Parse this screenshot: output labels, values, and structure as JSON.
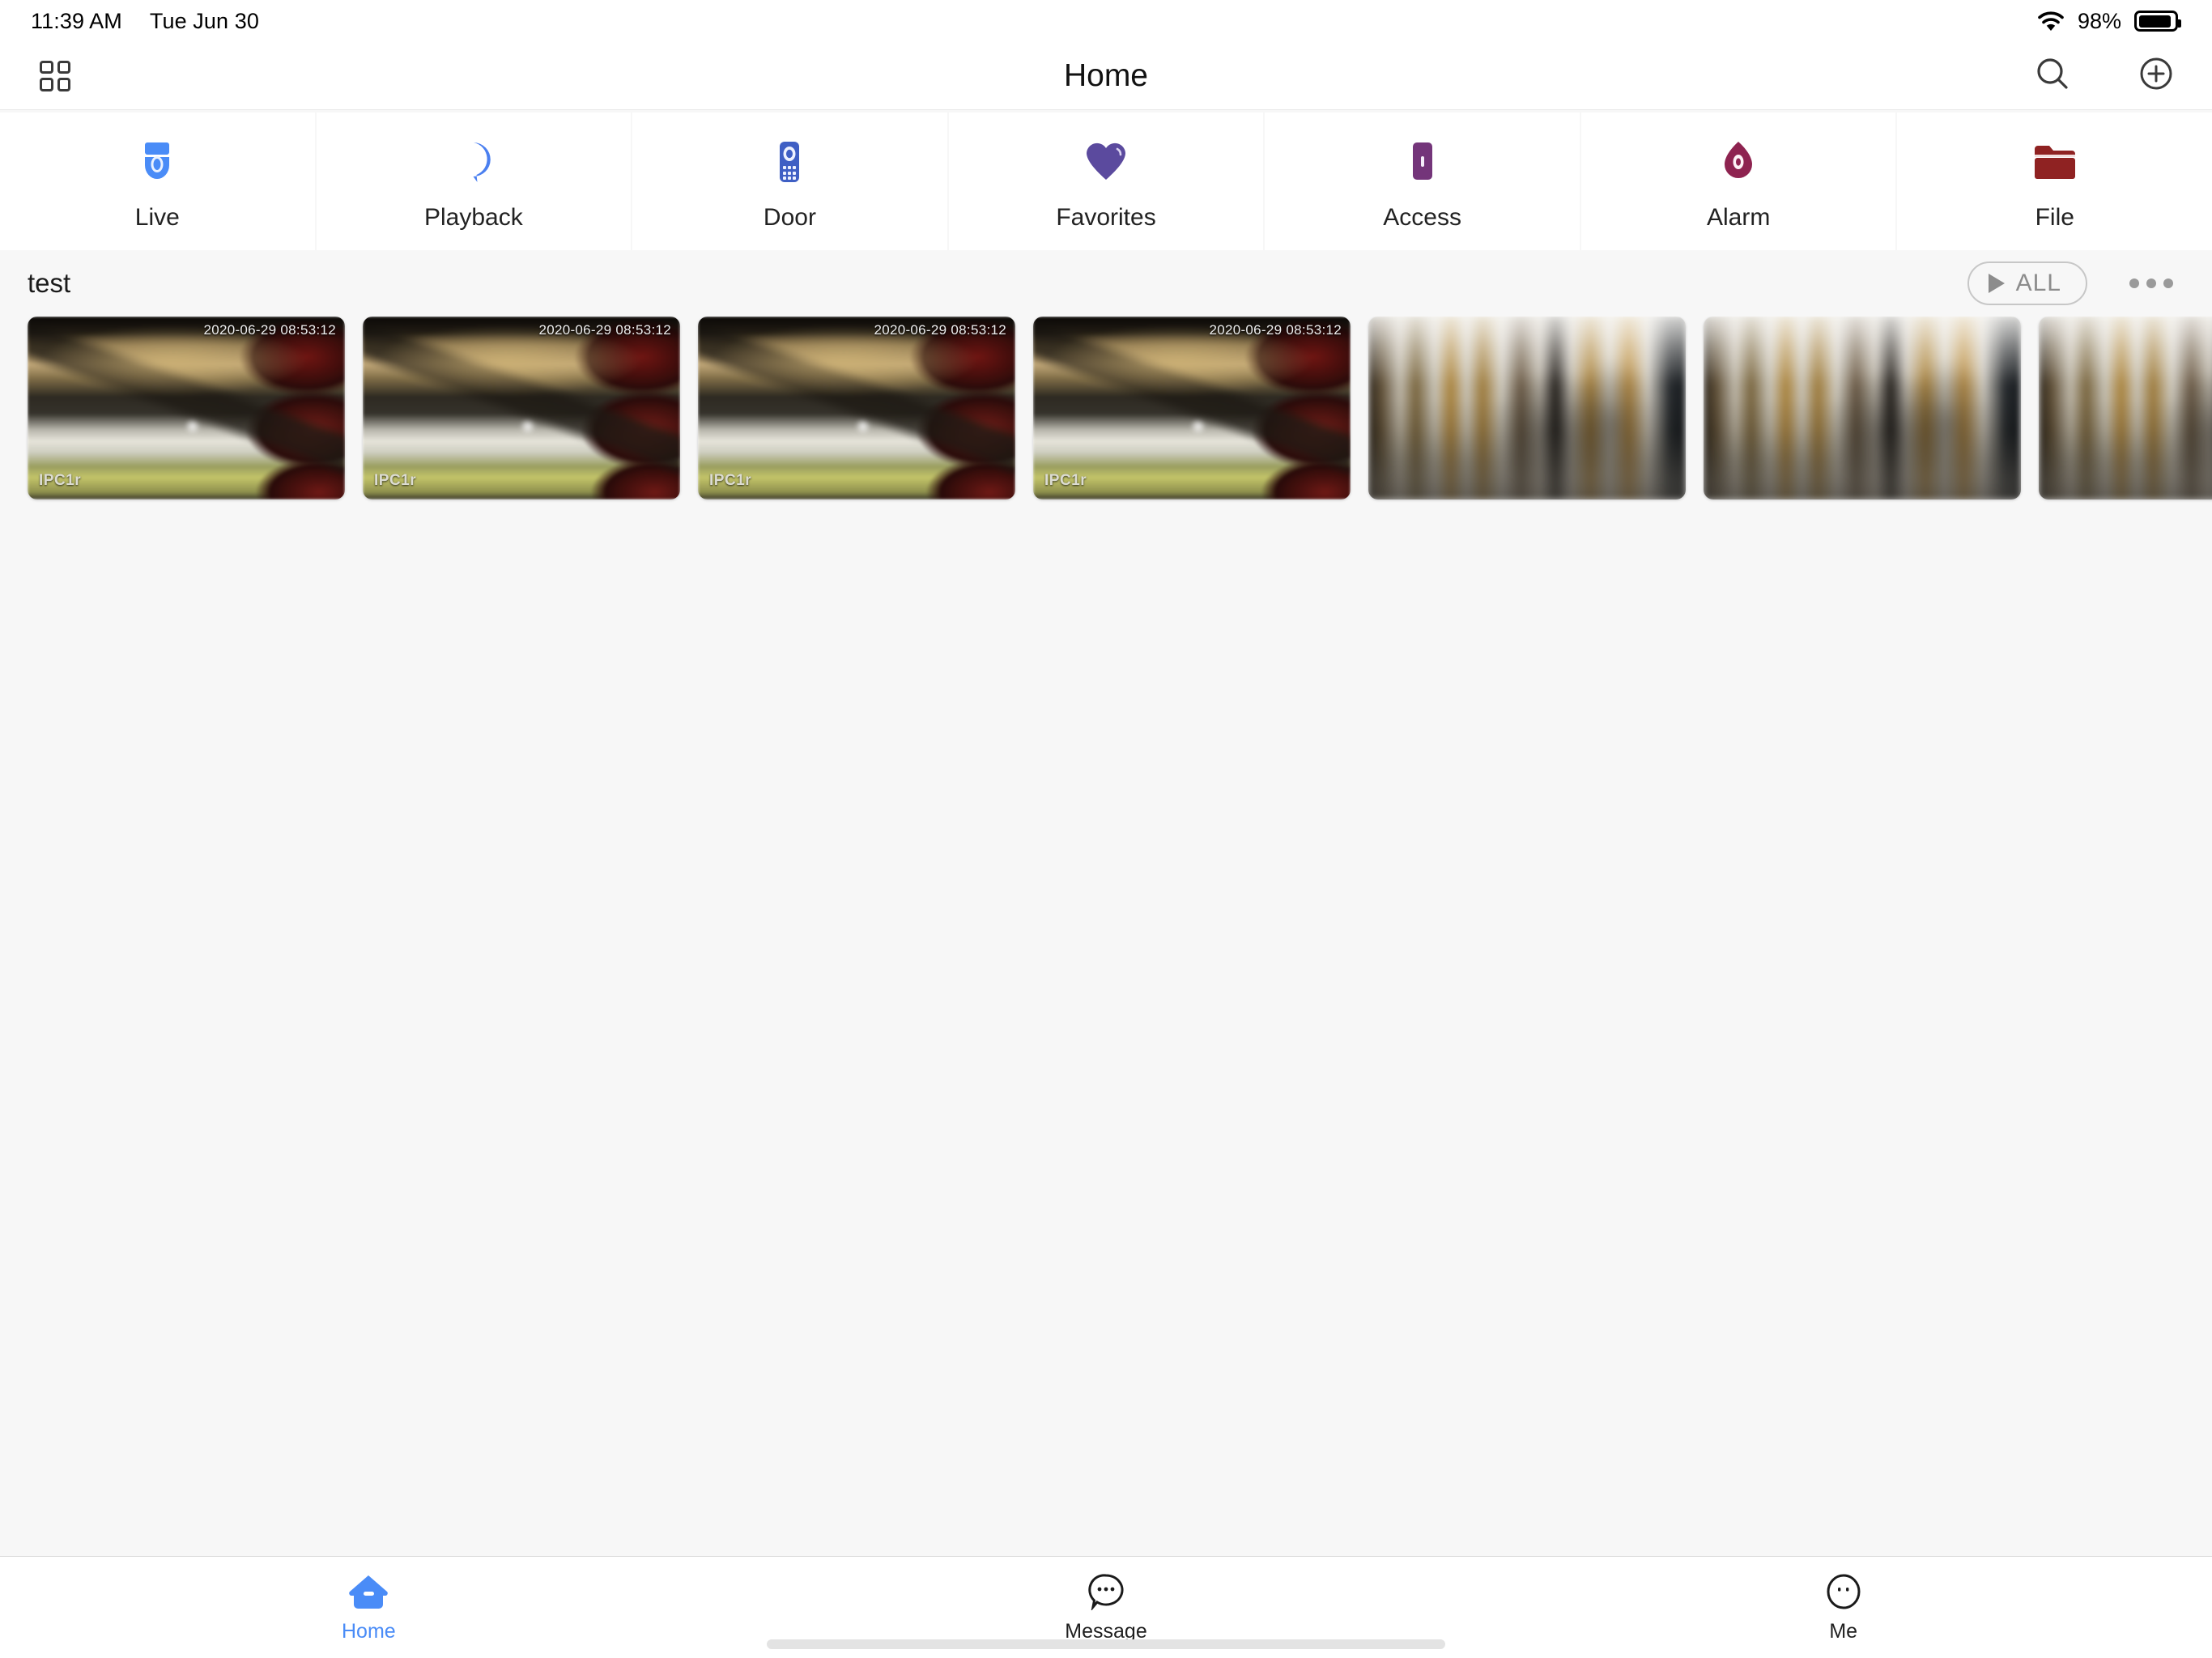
{
  "status_bar": {
    "time": "11:39 AM",
    "date": "Tue Jun 30",
    "battery_percent": "98%",
    "wifi_icon": "wifi-icon",
    "battery_icon": "battery-icon"
  },
  "nav": {
    "grid_icon": "grid-view-icon",
    "title": "Home",
    "search_icon": "search-icon",
    "add_icon": "add-circle-icon"
  },
  "categories": [
    {
      "label": "Live",
      "icon": "dome-camera-icon",
      "color": "#4a8cf7"
    },
    {
      "label": "Playback",
      "icon": "playback-reel-icon",
      "color": "#4a7ff0"
    },
    {
      "label": "Door",
      "icon": "intercom-icon",
      "color": "#3f5fc4"
    },
    {
      "label": "Favorites",
      "icon": "heart-icon",
      "color": "#5b4a9e"
    },
    {
      "label": "Access",
      "icon": "access-door-icon",
      "color": "#74357a"
    },
    {
      "label": "Alarm",
      "icon": "alarm-siren-icon",
      "color": "#8e2350"
    },
    {
      "label": "File",
      "icon": "folder-icon",
      "color": "#8f2222"
    }
  ],
  "group": {
    "title": "test",
    "all_button_label": "ALL",
    "all_button_icon": "play-icon",
    "more_icon": "more-options-icon"
  },
  "thumbnails": [
    {
      "scene": "scene-a",
      "timestamp": "2020-06-29 08:53:12",
      "camera": "IPC1r"
    },
    {
      "scene": "scene-a",
      "timestamp": "2020-06-29 08:53:12",
      "camera": "IPC1r"
    },
    {
      "scene": "scene-a",
      "timestamp": "2020-06-29 08:53:12",
      "camera": "IPC1r"
    },
    {
      "scene": "scene-a",
      "timestamp": "2020-06-29 08:53:12",
      "camera": "IPC1r"
    },
    {
      "scene": "scene-b",
      "timestamp": "",
      "camera": ""
    },
    {
      "scene": "scene-b",
      "timestamp": "",
      "camera": ""
    },
    {
      "scene": "scene-b",
      "timestamp": "",
      "camera": ""
    }
  ],
  "tabs": [
    {
      "label": "Home",
      "icon": "home-icon",
      "active": true
    },
    {
      "label": "Message",
      "icon": "chat-bubble-icon",
      "active": false
    },
    {
      "label": "Me",
      "icon": "profile-face-icon",
      "active": false
    }
  ],
  "colors": {
    "accent": "#4a8cf7",
    "page_bg": "#f7f7f7",
    "surface": "#ffffff"
  }
}
